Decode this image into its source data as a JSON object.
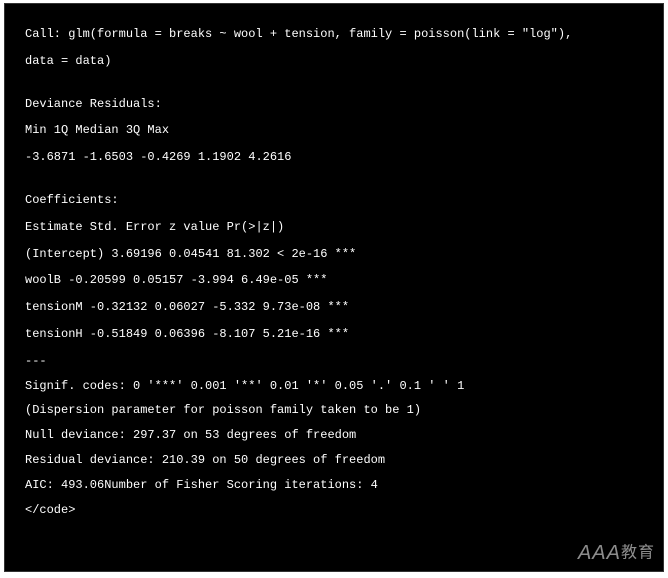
{
  "call_line1": "Call: glm(formula = breaks ~ wool + tension, family = poisson(link = \"log\"),",
  "call_line2": "data = data)",
  "deviance_heading": "Deviance Residuals:",
  "deviance_cols": "Min 1Q Median 3Q Max",
  "deviance_values": "-3.6871 -1.6503 -0.4269 1.1902 4.2616",
  "coef_heading": "Coefficients:",
  "coef_cols": "Estimate Std. Error z value Pr(>|z|)",
  "coef_intercept": "(Intercept) 3.69196 0.04541 81.302 < 2e-16 ***",
  "coef_woolB": "woolB -0.20599 0.05157 -3.994 6.49e-05 ***",
  "coef_tensionM": "tensionM -0.32132 0.06027 -5.332 9.73e-08 ***",
  "coef_tensionH": "tensionH -0.51849 0.06396 -8.107 5.21e-16 ***",
  "sep": "---",
  "signif": "Signif. codes: 0 '***' 0.001 '**' 0.01 '*' 0.05 '.' 0.1 ' ' 1",
  "dispersion": "(Dispersion parameter for poisson family taken to be 1)",
  "null_dev": "Null deviance: 297.37 on 53 degrees of freedom",
  "resid_dev": "Residual deviance: 210.39 on 50 degrees of freedom",
  "aic_line": "AIC: 493.06Number of Fisher Scoring iterations: 4",
  "end_tag": "</code>",
  "watermark_en": "AAA",
  "watermark_han": "教育"
}
